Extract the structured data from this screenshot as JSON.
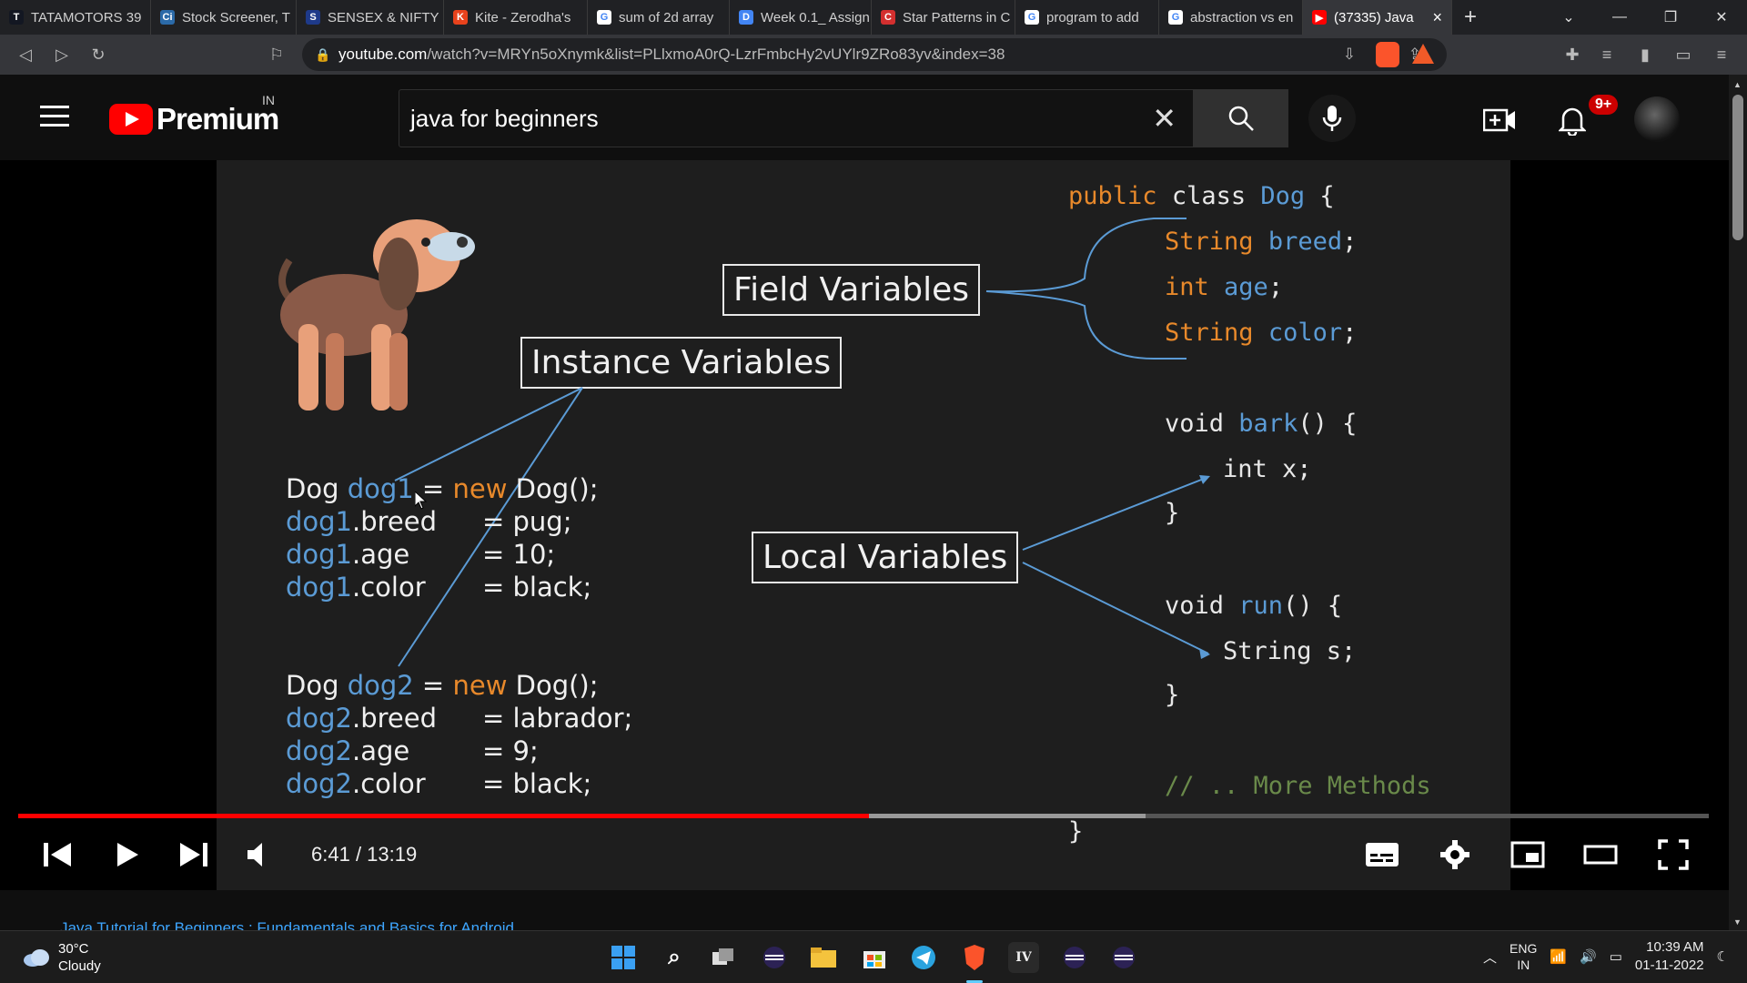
{
  "tabs": [
    {
      "title": "TATAMOTORS 39",
      "icon": "tradingview-icon",
      "fav": "T",
      "color": "#131722"
    },
    {
      "title": "Stock Screener, T",
      "icon": "screener-icon",
      "fav": "Ci",
      "color": "#2b6aa8"
    },
    {
      "title": "SENSEX & NIFTY",
      "icon": "sensex-icon",
      "fav": "S",
      "color": "#1e3a8a"
    },
    {
      "title": "Kite - Zerodha's",
      "icon": "kite-icon",
      "fav": "K",
      "color": "#e8421c"
    },
    {
      "title": "sum of 2d array",
      "icon": "google-icon",
      "fav": "G",
      "color": "#ffffff"
    },
    {
      "title": "Week 0.1_ Assign",
      "icon": "docs-icon",
      "fav": "D",
      "color": "#4285f4"
    },
    {
      "title": "Star Patterns in C",
      "icon": "site-icon",
      "fav": "C",
      "color": "#d32f2f"
    },
    {
      "title": "program to add",
      "icon": "google-icon",
      "fav": "G",
      "color": "#ffffff"
    },
    {
      "title": "abstraction vs en",
      "icon": "google-icon",
      "fav": "G",
      "color": "#ffffff"
    },
    {
      "title": "(37335) Java",
      "icon": "youtube-icon",
      "fav": "▶",
      "color": "#ff0000",
      "active": true
    }
  ],
  "browser": {
    "url_domain": "youtube.com",
    "url_path": "/watch?v=MRYn5oXnymk&list=PLlxmoA0rQ-LzrFmbcHy2vUYlr9ZRo83yv&index=38",
    "brave_count": "40"
  },
  "youtube": {
    "logo_text": "Premium",
    "country": "IN",
    "search_value": "java for beginners",
    "notif_count": "9+"
  },
  "slide": {
    "field_label": "Field Variables",
    "instance_label": "Instance Variables",
    "local_label": "Local Variables",
    "class_kw": "public",
    "class_word": "class",
    "class_name": "Dog",
    "brace_open": "{",
    "f1_type": "String",
    "f1_name": "breed",
    "f2_type": "int",
    "f2_name": "age",
    "f3_type": "String",
    "f3_name": "color",
    "m1_ret": "void",
    "m1_name": "bark",
    "m1_local": "int x;",
    "m2_ret": "void",
    "m2_name": "run",
    "m2_local": "String s;",
    "more": "// .. More Methods",
    "close": "}",
    "dog1": [
      {
        "pre": "Dog ",
        "var": "dog1",
        "mid": " = ",
        "kw": "new",
        "post": " Dog();"
      },
      {
        "var": "dog1",
        "field": ".breed",
        "val": "= pug;"
      },
      {
        "var": "dog1",
        "field": ".age",
        "val": "= 10;"
      },
      {
        "var": "dog1",
        "field": ".color",
        "val": "= black;"
      }
    ],
    "dog2": [
      {
        "pre": "Dog ",
        "var": "dog2",
        "mid": " = ",
        "kw": "new",
        "post": " Dog();"
      },
      {
        "var": "dog2",
        "field": ".breed",
        "val": "= labrador;"
      },
      {
        "var": "dog2",
        "field": ".age",
        "val": "= 9;"
      },
      {
        "var": "dog2",
        "field": ".color",
        "val": "= black;"
      }
    ]
  },
  "player": {
    "time_current": "6:41",
    "time_total": "13:19",
    "progress": 0.503,
    "buffered": 0.667
  },
  "below_title": "Java Tutorial for Beginners : Fundamentals and Basics for Android",
  "taskbar": {
    "temp": "30°C",
    "weather": "Cloudy",
    "lang1": "ENG",
    "lang2": "IN",
    "time": "10:39 AM",
    "date": "01-11-2022"
  }
}
